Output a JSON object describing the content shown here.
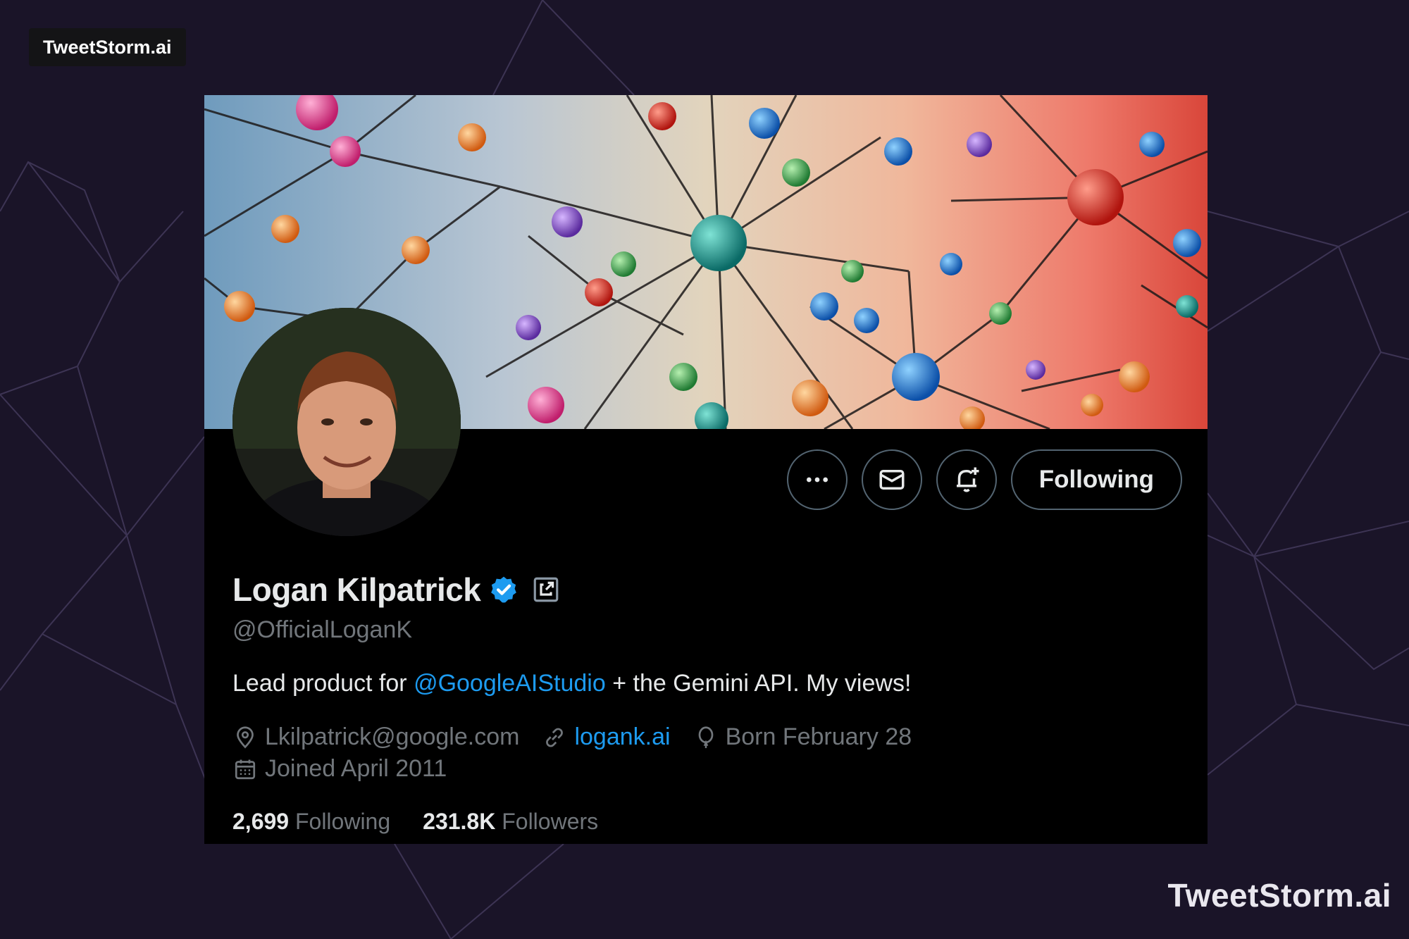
{
  "brand": {
    "badge_text": "TweetStorm.ai",
    "watermark_text": "TweetStorm.ai"
  },
  "profile": {
    "name": "Logan Kilpatrick",
    "verified": true,
    "handle": "@OfficialLoganK",
    "bio": {
      "before": "Lead product for ",
      "mention": "@GoogleAIStudio",
      "after": " + the Gemini API. My views!"
    },
    "location": "Lkilpatrick@google.com",
    "website": "logank.ai",
    "birthday": "Born February 28",
    "joined": "Joined April 2011",
    "following_count": "2,699",
    "following_label": "Following",
    "followers_count": "231.8K",
    "followers_label": "Followers"
  },
  "actions": {
    "more_icon": "more-icon",
    "message_icon": "envelope-icon",
    "notify_icon": "bell-plus-icon",
    "follow_label": "Following"
  },
  "colors": {
    "background": "#1a1428",
    "card": "#000000",
    "accent_blue": "#1d9bf0",
    "muted_text": "#71767b",
    "text": "#e7e9ea"
  }
}
